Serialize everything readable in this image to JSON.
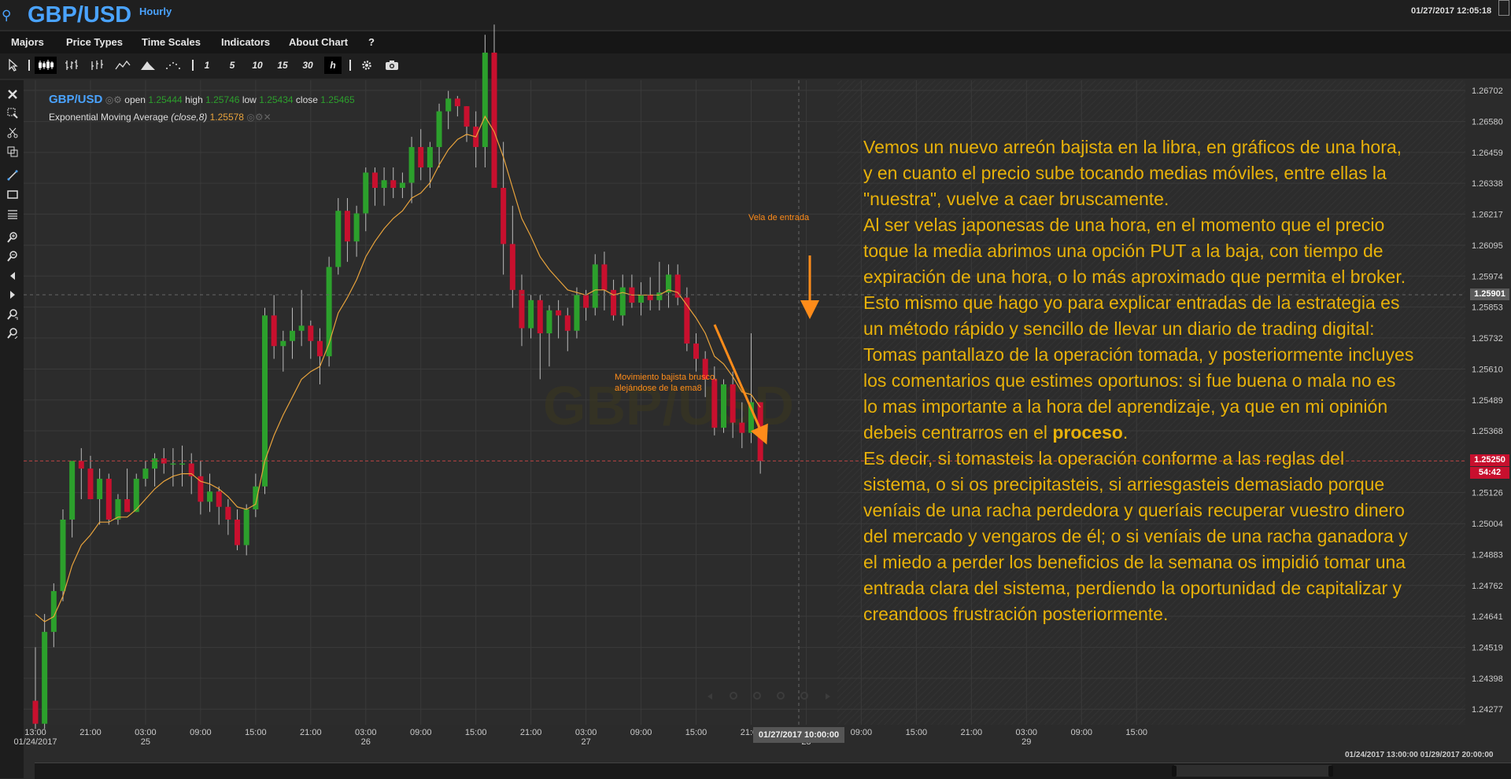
{
  "header": {
    "symbol": "GBP/USD",
    "interval": "Hourly",
    "datetime": "01/27/2017 12:05:18",
    "search_icon": "search-icon"
  },
  "menu": [
    "Majors",
    "Price Types",
    "Time Scales",
    "Indicators",
    "About Chart",
    "?"
  ],
  "toolbar": {
    "chart_types": [
      "candlestick-icon",
      "ohlc-bars-icon",
      "hlc-bars-icon",
      "line-icon",
      "mountain-icon",
      "dots-icon"
    ],
    "periods": [
      "1",
      "5",
      "10",
      "15",
      "30",
      "h"
    ],
    "active_period": "h",
    "active_chart_type": "candlestick-icon",
    "settings_icon": "gear-icon",
    "camera_icon": "camera-icon"
  },
  "side_tools": [
    "close-icon",
    "zoom-select-icon",
    "scissors-icon",
    "duplicate-icon",
    "trendline-icon",
    "rectangle-icon",
    "fibonacci-icon",
    "zoom-in-icon",
    "zoom-out-icon",
    "scroll-left-icon",
    "scroll-right-icon",
    "zoom-in-time-icon",
    "zoom-out-time-icon"
  ],
  "legend": {
    "symbol": "GBP/USD",
    "open_label": "open",
    "open": "1.25444",
    "high_label": "high",
    "high": "1.25746",
    "low_label": "low",
    "low": "1.25434",
    "close_label": "close",
    "close": "1.25465",
    "ema_label": "Exponential Moving Average",
    "ema_params": "(close,8)",
    "ema_value": "1.25578"
  },
  "watermark": "GBP/USD",
  "y_axis": [
    "1.26702",
    "1.26580",
    "1.26459",
    "1.26338",
    "1.26217",
    "1.26095",
    "1.25974",
    "1.25853",
    "1.25732",
    "1.25610",
    "1.25489",
    "1.25368",
    "1.25126",
    "1.25004",
    "1.24883",
    "1.24762",
    "1.24641",
    "1.24519",
    "1.24398",
    "1.24277"
  ],
  "crosshair_price": "1.25901",
  "current_price": "1.25250",
  "countdown": "54:42",
  "x_axis": [
    {
      "time": "13:00",
      "date": "01/24/2017"
    },
    {
      "time": "21:00",
      "date": ""
    },
    {
      "time": "03:00",
      "date": "25"
    },
    {
      "time": "09:00",
      "date": ""
    },
    {
      "time": "15:00",
      "date": ""
    },
    {
      "time": "21:00",
      "date": ""
    },
    {
      "time": "03:00",
      "date": "26"
    },
    {
      "time": "09:00",
      "date": ""
    },
    {
      "time": "15:00",
      "date": ""
    },
    {
      "time": "21:00",
      "date": ""
    },
    {
      "time": "03:00",
      "date": "27"
    },
    {
      "time": "09:00",
      "date": ""
    },
    {
      "time": "15:00",
      "date": ""
    },
    {
      "time": "21:00",
      "date": ""
    },
    {
      "time": "03:00",
      "date": "28"
    },
    {
      "time": "09:00",
      "date": ""
    },
    {
      "time": "15:00",
      "date": ""
    },
    {
      "time": "21:00",
      "date": ""
    },
    {
      "time": "03:00",
      "date": "29"
    },
    {
      "time": "09:00",
      "date": ""
    },
    {
      "time": "15:00",
      "date": ""
    }
  ],
  "cursor_date": "01/27/2017 10:00:00",
  "scroll_range": "01/24/2017 13:00:00   01/29/2017 20:00:00",
  "annotations": {
    "entry_label": "Vela de entrada",
    "movement_label_1": "Movimiento bajista brusco,",
    "movement_label_2": "alejándose de la ema8",
    "commentary_1": "Vemos un nuevo arreón bajista en la libra, en gráficos de una hora, y en cuanto el precio sube tocando medias móviles, entre ellas la \"nuestra\", vuelve a caer bruscamente.",
    "commentary_2": "Al ser velas japonesas de una hora, en el momento que el precio toque la media abrimos una opción PUT a la baja, con tiempo de expiración de una hora, o lo más aproximado que permita el broker.",
    "commentary_3": "Esto mismo que hago yo para explicar entradas de la estrategia es un método rápido y sencillo de llevar un diario de trading digital:",
    "commentary_4a": "Tomas pantallazo de la operación tomada, y posteriormente incluyes los comentarios que estimes oportunos: si fue buena o mala no es lo mas importante a la hora del aprendizaje, ya que en mi opinión debeis centrarros en el ",
    "commentary_4b": "proceso",
    "commentary_4c": ".",
    "commentary_5": "Es decir, si tomasteis la operación conforme a las reglas del sistema, o si os precipitasteis, si arriesgasteis demasiado porque veníais de una racha perdedora y queríais recuperar vuestro dinero del mercado y vengaros de él; o si veníais de una racha ganadora y el miedo a perder los beneficios de la semana os impidió tomar una entrada clara del sistema, perdiendo la oportunidad de capitalizar y creandoos frustración posteriormente."
  },
  "colors": {
    "bull": "#2ca02c",
    "bear": "#c8102e",
    "ema": "#e8a33c",
    "accent": "#4aa3ff",
    "annotation": "#e7b10a",
    "arrow": "#ff8c1a"
  },
  "chart_data": {
    "type": "candlestick",
    "x_unit": "hour",
    "candles": [
      {
        "o": 1.2431,
        "h": 1.2452,
        "l": 1.242,
        "c": 1.2422
      },
      {
        "o": 1.2422,
        "h": 1.2465,
        "l": 1.242,
        "c": 1.2458
      },
      {
        "o": 1.2458,
        "h": 1.2477,
        "l": 1.2452,
        "c": 1.2474
      },
      {
        "o": 1.2474,
        "h": 1.2506,
        "l": 1.247,
        "c": 1.2502
      },
      {
        "o": 1.2502,
        "h": 1.2525,
        "l": 1.2495,
        "c": 1.2525
      },
      {
        "o": 1.2525,
        "h": 1.253,
        "l": 1.251,
        "c": 1.2522
      },
      {
        "o": 1.2522,
        "h": 1.2527,
        "l": 1.251,
        "c": 1.251
      },
      {
        "o": 1.251,
        "h": 1.2522,
        "l": 1.25,
        "c": 1.2518
      },
      {
        "o": 1.2518,
        "h": 1.252,
        "l": 1.25,
        "c": 1.2502
      },
      {
        "o": 1.2502,
        "h": 1.2512,
        "l": 1.25,
        "c": 1.251
      },
      {
        "o": 1.251,
        "h": 1.2522,
        "l": 1.2508,
        "c": 1.2505
      },
      {
        "o": 1.2505,
        "h": 1.252,
        "l": 1.2505,
        "c": 1.2518
      },
      {
        "o": 1.2518,
        "h": 1.2525,
        "l": 1.2515,
        "c": 1.2522
      },
      {
        "o": 1.2522,
        "h": 1.2528,
        "l": 1.2515,
        "c": 1.2526
      },
      {
        "o": 1.2526,
        "h": 1.253,
        "l": 1.252,
        "c": 1.2524
      },
      {
        "o": 1.2524,
        "h": 1.253,
        "l": 1.2515,
        "c": 1.2524
      },
      {
        "o": 1.2524,
        "h": 1.2531,
        "l": 1.2515,
        "c": 1.2524
      },
      {
        "o": 1.2524,
        "h": 1.2528,
        "l": 1.2512,
        "c": 1.2519
      },
      {
        "o": 1.2519,
        "h": 1.2525,
        "l": 1.2504,
        "c": 1.2509
      },
      {
        "o": 1.2509,
        "h": 1.252,
        "l": 1.2505,
        "c": 1.2513
      },
      {
        "o": 1.2513,
        "h": 1.2515,
        "l": 1.25,
        "c": 1.2507
      },
      {
        "o": 1.2507,
        "h": 1.251,
        "l": 1.2496,
        "c": 1.2502
      },
      {
        "o": 1.2502,
        "h": 1.2506,
        "l": 1.249,
        "c": 1.2492
      },
      {
        "o": 1.2492,
        "h": 1.2508,
        "l": 1.2488,
        "c": 1.2506
      },
      {
        "o": 1.2506,
        "h": 1.252,
        "l": 1.2503,
        "c": 1.2515
      },
      {
        "o": 1.2515,
        "h": 1.2585,
        "l": 1.2512,
        "c": 1.2582
      },
      {
        "o": 1.2582,
        "h": 1.259,
        "l": 1.2565,
        "c": 1.257
      },
      {
        "o": 1.257,
        "h": 1.2576,
        "l": 1.256,
        "c": 1.2572
      },
      {
        "o": 1.2572,
        "h": 1.2585,
        "l": 1.2565,
        "c": 1.2576
      },
      {
        "o": 1.2576,
        "h": 1.2592,
        "l": 1.257,
        "c": 1.2578
      },
      {
        "o": 1.2578,
        "h": 1.258,
        "l": 1.2565,
        "c": 1.2572
      },
      {
        "o": 1.2572,
        "h": 1.2577,
        "l": 1.2555,
        "c": 1.2566
      },
      {
        "o": 1.2566,
        "h": 1.2605,
        "l": 1.2562,
        "c": 1.2601
      },
      {
        "o": 1.2601,
        "h": 1.2628,
        "l": 1.2598,
        "c": 1.2623
      },
      {
        "o": 1.2623,
        "h": 1.2628,
        "l": 1.2603,
        "c": 1.2611
      },
      {
        "o": 1.2611,
        "h": 1.2625,
        "l": 1.2605,
        "c": 1.2622
      },
      {
        "o": 1.2622,
        "h": 1.264,
        "l": 1.2615,
        "c": 1.2638
      },
      {
        "o": 1.2638,
        "h": 1.264,
        "l": 1.2625,
        "c": 1.2632
      },
      {
        "o": 1.2632,
        "h": 1.264,
        "l": 1.2625,
        "c": 1.2635
      },
      {
        "o": 1.2635,
        "h": 1.264,
        "l": 1.2628,
        "c": 1.2632
      },
      {
        "o": 1.2632,
        "h": 1.2638,
        "l": 1.2628,
        "c": 1.2634
      },
      {
        "o": 1.2634,
        "h": 1.2652,
        "l": 1.2626,
        "c": 1.2648
      },
      {
        "o": 1.2648,
        "h": 1.2655,
        "l": 1.2635,
        "c": 1.264
      },
      {
        "o": 1.264,
        "h": 1.265,
        "l": 1.2632,
        "c": 1.2648
      },
      {
        "o": 1.2648,
        "h": 1.2665,
        "l": 1.264,
        "c": 1.2662
      },
      {
        "o": 1.2662,
        "h": 1.267,
        "l": 1.2655,
        "c": 1.2667
      },
      {
        "o": 1.2667,
        "h": 1.2668,
        "l": 1.266,
        "c": 1.2664
      },
      {
        "o": 1.2664,
        "h": 1.2655,
        "l": 1.265,
        "c": 1.2656
      },
      {
        "o": 1.2656,
        "h": 1.2662,
        "l": 1.264,
        "c": 1.2648
      },
      {
        "o": 1.2648,
        "h": 1.2692,
        "l": 1.264,
        "c": 1.2685
      },
      {
        "o": 1.2685,
        "h": 1.2696,
        "l": 1.264,
        "c": 1.2632
      },
      {
        "o": 1.2632,
        "h": 1.265,
        "l": 1.2598,
        "c": 1.261
      },
      {
        "o": 1.261,
        "h": 1.2625,
        "l": 1.2585,
        "c": 1.2592
      },
      {
        "o": 1.2592,
        "h": 1.2598,
        "l": 1.257,
        "c": 1.2577
      },
      {
        "o": 1.2577,
        "h": 1.259,
        "l": 1.2573,
        "c": 1.2588
      },
      {
        "o": 1.2588,
        "h": 1.259,
        "l": 1.2557,
        "c": 1.2575
      },
      {
        "o": 1.2575,
        "h": 1.2586,
        "l": 1.2562,
        "c": 1.2584
      },
      {
        "o": 1.2584,
        "h": 1.2588,
        "l": 1.2573,
        "c": 1.2582
      },
      {
        "o": 1.2582,
        "h": 1.2585,
        "l": 1.2568,
        "c": 1.2576
      },
      {
        "o": 1.2576,
        "h": 1.2593,
        "l": 1.2573,
        "c": 1.259
      },
      {
        "o": 1.259,
        "h": 1.2592,
        "l": 1.258,
        "c": 1.2585
      },
      {
        "o": 1.2585,
        "h": 1.2606,
        "l": 1.2582,
        "c": 1.2602
      },
      {
        "o": 1.2602,
        "h": 1.2607,
        "l": 1.2584,
        "c": 1.2592
      },
      {
        "o": 1.2592,
        "h": 1.2596,
        "l": 1.258,
        "c": 1.2582
      },
      {
        "o": 1.2582,
        "h": 1.2598,
        "l": 1.2578,
        "c": 1.2593
      },
      {
        "o": 1.2593,
        "h": 1.2598,
        "l": 1.2585,
        "c": 1.2587
      },
      {
        "o": 1.2587,
        "h": 1.2595,
        "l": 1.2582,
        "c": 1.259
      },
      {
        "o": 1.259,
        "h": 1.2597,
        "l": 1.2584,
        "c": 1.2588
      },
      {
        "o": 1.2588,
        "h": 1.2603,
        "l": 1.2584,
        "c": 1.2591
      },
      {
        "o": 1.2591,
        "h": 1.2602,
        "l": 1.2585,
        "c": 1.2598
      },
      {
        "o": 1.2598,
        "h": 1.2602,
        "l": 1.2586,
        "c": 1.2589
      },
      {
        "o": 1.2589,
        "h": 1.2593,
        "l": 1.2568,
        "c": 1.2571
      },
      {
        "o": 1.2571,
        "h": 1.2575,
        "l": 1.256,
        "c": 1.2565
      },
      {
        "o": 1.2565,
        "h": 1.2568,
        "l": 1.255,
        "c": 1.2557
      },
      {
        "o": 1.2557,
        "h": 1.2562,
        "l": 1.2535,
        "c": 1.2538
      },
      {
        "o": 1.2538,
        "h": 1.2557,
        "l": 1.2536,
        "c": 1.2555
      },
      {
        "o": 1.2555,
        "h": 1.256,
        "l": 1.2534,
        "c": 1.254
      },
      {
        "o": 1.254,
        "h": 1.2548,
        "l": 1.253,
        "c": 1.2536
      },
      {
        "o": 1.2536,
        "h": 1.2575,
        "l": 1.2532,
        "c": 1.2548
      },
      {
        "o": 1.2548,
        "h": 1.2548,
        "l": 1.252,
        "c": 1.2525
      }
    ],
    "ema": {
      "name": "Exponential Moving Average (close,8)",
      "values": [
        1.2465,
        1.2462,
        1.2464,
        1.2472,
        1.2484,
        1.2492,
        1.2496,
        1.2501,
        1.2501,
        1.2503,
        1.2503,
        1.2506,
        1.251,
        1.2514,
        1.2517,
        1.2519,
        1.252,
        1.252,
        1.2517,
        1.2516,
        1.2514,
        1.2511,
        1.2507,
        1.2506,
        1.2508,
        1.2525,
        1.2535,
        1.2543,
        1.255,
        1.2557,
        1.256,
        1.2562,
        1.2571,
        1.2583,
        1.2589,
        1.2596,
        1.2605,
        1.2611,
        1.2616,
        1.262,
        1.2623,
        1.2628,
        1.263,
        1.2634,
        1.2641,
        1.2647,
        1.2651,
        1.2653,
        1.2652,
        1.266,
        1.2654,
        1.2644,
        1.2632,
        1.262,
        1.2613,
        1.2605,
        1.26,
        1.2596,
        1.2592,
        1.2591,
        1.259,
        1.2592,
        1.2592,
        1.259,
        1.2591,
        1.259,
        1.259,
        1.259,
        1.259,
        1.2592,
        1.2591,
        1.2586,
        1.2581,
        1.2575,
        1.2566,
        1.2563,
        1.2558,
        1.2552,
        1.2551,
        1.2546
      ]
    },
    "ylim": [
      1.24216,
      1.26742
    ],
    "y_ticks": [
      1.26702,
      1.2658,
      1.26459,
      1.26338,
      1.26217,
      1.26095,
      1.25974,
      1.25853,
      1.25732,
      1.2561,
      1.25489,
      1.25368,
      1.25126,
      1.25004,
      1.24883,
      1.24762,
      1.24641,
      1.24519,
      1.24398,
      1.24277
    ],
    "current_price_line": 1.2525,
    "crosshair_price_line": 1.25901
  }
}
